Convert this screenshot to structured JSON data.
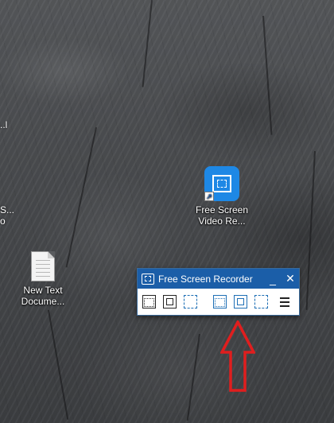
{
  "desktop": {
    "icons": [
      {
        "id": "app",
        "label_line1": "Free Screen",
        "label_line2": "Video Re..."
      },
      {
        "id": "doc",
        "label_line1": "New Text",
        "label_line2": "Docume..."
      }
    ],
    "partial_left": [
      {
        "text": "..l"
      },
      {
        "text": "S..."
      },
      {
        "text": "o"
      }
    ]
  },
  "recorder": {
    "title": "Free Screen Recorder",
    "minimize_label": "_",
    "close_label": "✕",
    "tools": [
      {
        "name": "record-region-icon"
      },
      {
        "name": "record-window-icon"
      },
      {
        "name": "record-fullscreen-icon"
      },
      {
        "name": "screenshot-region-icon"
      },
      {
        "name": "screenshot-window-icon"
      },
      {
        "name": "screenshot-fullscreen-icon"
      },
      {
        "name": "menu-icon"
      }
    ]
  },
  "annotation": {
    "arrow_color": "#e01e1e"
  },
  "colors": {
    "titlebar": "#1b5ea8",
    "app_icon": "#1e88e5"
  }
}
